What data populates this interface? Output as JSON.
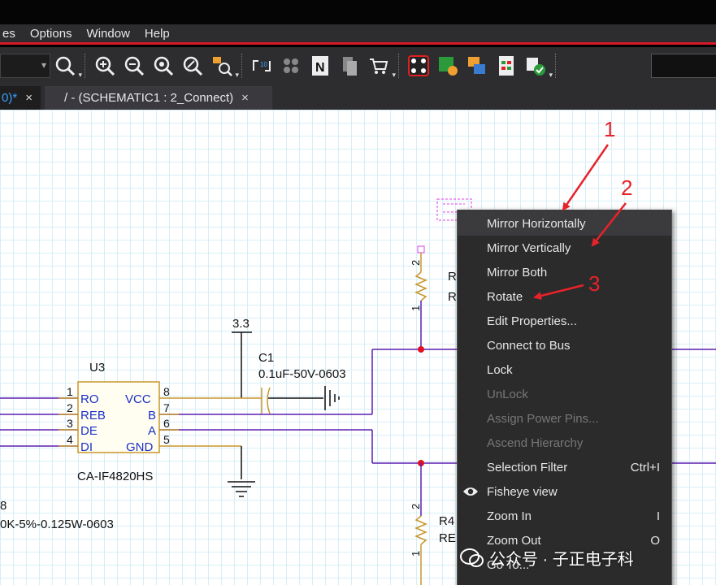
{
  "menubar": {
    "items": [
      "es",
      "Options",
      "Window",
      "Help"
    ]
  },
  "tabs": [
    {
      "label": "0)*",
      "close": "×"
    },
    {
      "label": "/ - (SCHEMATIC1 : 2_Connect)",
      "close": "×"
    }
  ],
  "schematic": {
    "power_label": "3.3",
    "c1_ref": "C1",
    "c1_value": "0.1uF-50V-0603",
    "u3_ref": "U3",
    "u3_part": "CA-IF4820HS",
    "u3_left_pins": [
      {
        "num": "1",
        "name": "RO"
      },
      {
        "num": "2",
        "name": "REB"
      },
      {
        "num": "3",
        "name": "DE"
      },
      {
        "num": "4",
        "name": "DI"
      }
    ],
    "u3_right_pins": [
      {
        "num": "8",
        "name": "VCC"
      },
      {
        "num": "7",
        "name": "B"
      },
      {
        "num": "6",
        "name": "A"
      },
      {
        "num": "5",
        "name": "GND"
      }
    ],
    "left_ref_partial": "8",
    "left_value_partial": "0K-5%-0.125W-0603",
    "r_top_pin2": "2",
    "r_top_pin1": "1",
    "r_top_ref_partial": "R",
    "r_top_val_partial": "R",
    "r_bottom_pin2": "2",
    "r_bottom_pin1": "1",
    "r_bottom_ref_partial": "R4",
    "r_bottom_val_partial": "RE"
  },
  "context_menu": {
    "items": [
      {
        "label": "Mirror Horizontally",
        "shortcut": "",
        "enabled": true
      },
      {
        "label": "Mirror Vertically",
        "shortcut": "",
        "enabled": true
      },
      {
        "label": "Mirror Both",
        "shortcut": "",
        "enabled": true
      },
      {
        "label": "Rotate",
        "shortcut": "",
        "enabled": true
      },
      {
        "label": "Edit Properties...",
        "shortcut": "",
        "enabled": true
      },
      {
        "label": "Connect to Bus",
        "shortcut": "",
        "enabled": true
      },
      {
        "label": "Lock",
        "shortcut": "",
        "enabled": true
      },
      {
        "label": "UnLock",
        "shortcut": "",
        "enabled": false
      },
      {
        "label": "Assign Power Pins...",
        "shortcut": "",
        "enabled": false
      },
      {
        "label": "Ascend Hierarchy",
        "shortcut": "",
        "enabled": false
      },
      {
        "label": "Selection Filter",
        "shortcut": "Ctrl+I",
        "enabled": true
      },
      {
        "label": "Fisheye view",
        "shortcut": "",
        "enabled": true
      },
      {
        "label": "Zoom In",
        "shortcut": "I",
        "enabled": true
      },
      {
        "label": "Zoom Out",
        "shortcut": "O",
        "enabled": true
      },
      {
        "label": "Go To...",
        "shortcut": "",
        "enabled": true
      }
    ]
  },
  "annotations": [
    "1",
    "2",
    "3"
  ],
  "watermark": "公众号 · 子正电子科",
  "colors": {
    "menu_accent": "#d61a2a",
    "annotation": "#e8222a",
    "wire": "#5a1fb0",
    "component": "#c8962a",
    "junction": "#e01020",
    "pin_name": "#1a2fc8"
  }
}
